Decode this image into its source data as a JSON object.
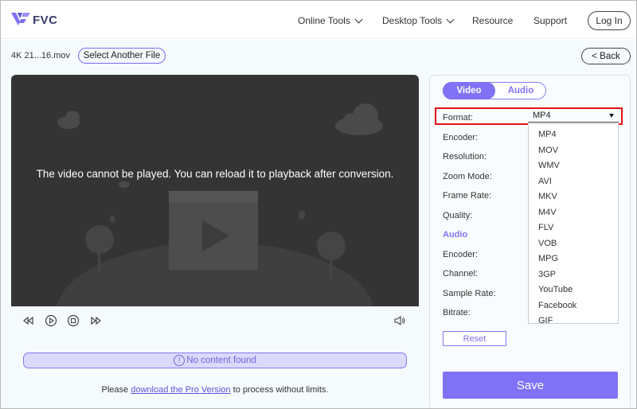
{
  "header": {
    "logo_text": "FVC",
    "nav": [
      {
        "label": "Online Tools",
        "has_menu": true
      },
      {
        "label": "Desktop Tools",
        "has_menu": true
      },
      {
        "label": "Resource",
        "has_menu": false
      },
      {
        "label": "Support",
        "has_menu": false
      }
    ],
    "login_label": "Log In"
  },
  "toolbar": {
    "filename": "4K 21...16.mov",
    "select_file_label": "Select Another File",
    "back_label": "< Back"
  },
  "player": {
    "message": "The video cannot be played. You can reload it to playback after conversion."
  },
  "status": {
    "icon_text": "!",
    "message": "No content found"
  },
  "promo": {
    "before": "Please ",
    "link": "download the Pro Version",
    "after": " to process without limits."
  },
  "settings": {
    "tabs": [
      "Video",
      "Audio"
    ],
    "active_tab": "Video",
    "video_labels": {
      "format": "Format:",
      "encoder": "Encoder:",
      "resolution": "Resolution:",
      "zoom_mode": "Zoom Mode:",
      "frame_rate": "Frame Rate:",
      "quality": "Quality:"
    },
    "audio_section_title": "Audio",
    "audio_labels": {
      "encoder": "Encoder:",
      "channel": "Channel:",
      "sample_rate": "Sample Rate:",
      "bitrate": "Bitrate:"
    },
    "format_value": "MP4",
    "format_options": [
      "MP4",
      "MOV",
      "WMV",
      "AVI",
      "MKV",
      "M4V",
      "FLV",
      "VOB",
      "MPG",
      "3GP",
      "YouTube",
      "Facebook",
      "GIF"
    ],
    "reset_label": "Reset",
    "save_label": "Save"
  },
  "colors": {
    "accent": "#7f72f4",
    "highlight_border": "#e01414",
    "player_bg": "#343434"
  }
}
